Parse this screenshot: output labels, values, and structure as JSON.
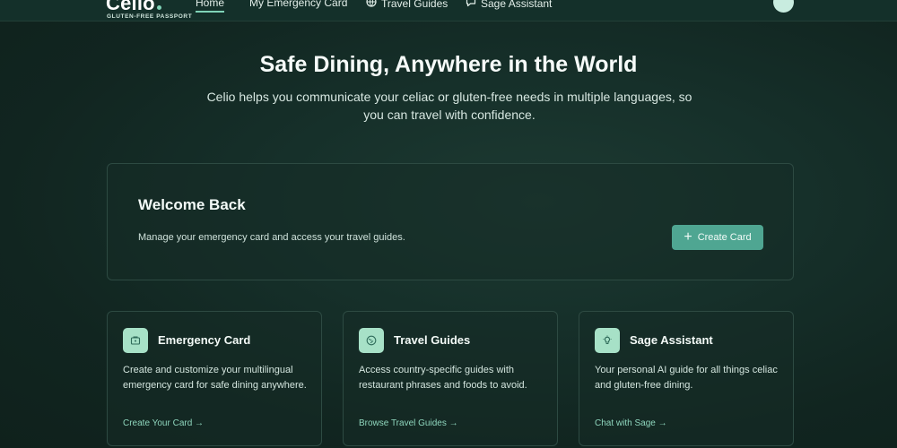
{
  "header": {
    "brand_name": "Celio",
    "brand_tagline": "GLUTEN-FREE PASSPORT",
    "nav": [
      {
        "label": "Home",
        "active": true,
        "icon": ""
      },
      {
        "label": "My Emergency Card",
        "active": false,
        "icon": ""
      },
      {
        "label": "Travel Guides",
        "active": false,
        "icon": "globe-icon"
      },
      {
        "label": "Sage Assistant",
        "active": false,
        "icon": "chat-icon"
      }
    ]
  },
  "hero": {
    "title": "Safe Dining, Anywhere in the World",
    "subtitle": "Celio helps you communicate your celiac or gluten-free needs in multiple languages, so you can travel with confidence."
  },
  "welcome": {
    "title": "Welcome Back",
    "text": "Manage your emergency card and access your travel guides.",
    "button_label": "Create Card",
    "button_icon": "plus-icon"
  },
  "features": [
    {
      "icon": "wallet-icon",
      "title": "Emergency Card",
      "description": "Create and customize your multilingual emergency card for safe dining anywhere.",
      "link": "Create Your Card →"
    },
    {
      "icon": "globe-icon",
      "title": "Travel Guides",
      "description": "Access country-specific guides with restaurant phrases and foods to avoid.",
      "link": "Browse Travel Guides →"
    },
    {
      "icon": "lightbulb-icon",
      "title": "Sage Assistant",
      "description": "Your personal AI guide for all things celiac and gluten-free dining.",
      "link": "Chat with Sage →"
    }
  ],
  "colors": {
    "background": "#112520",
    "accent": "#4fa692",
    "icon_tile": "#a7e1c7",
    "link": "#8fd6bd"
  }
}
